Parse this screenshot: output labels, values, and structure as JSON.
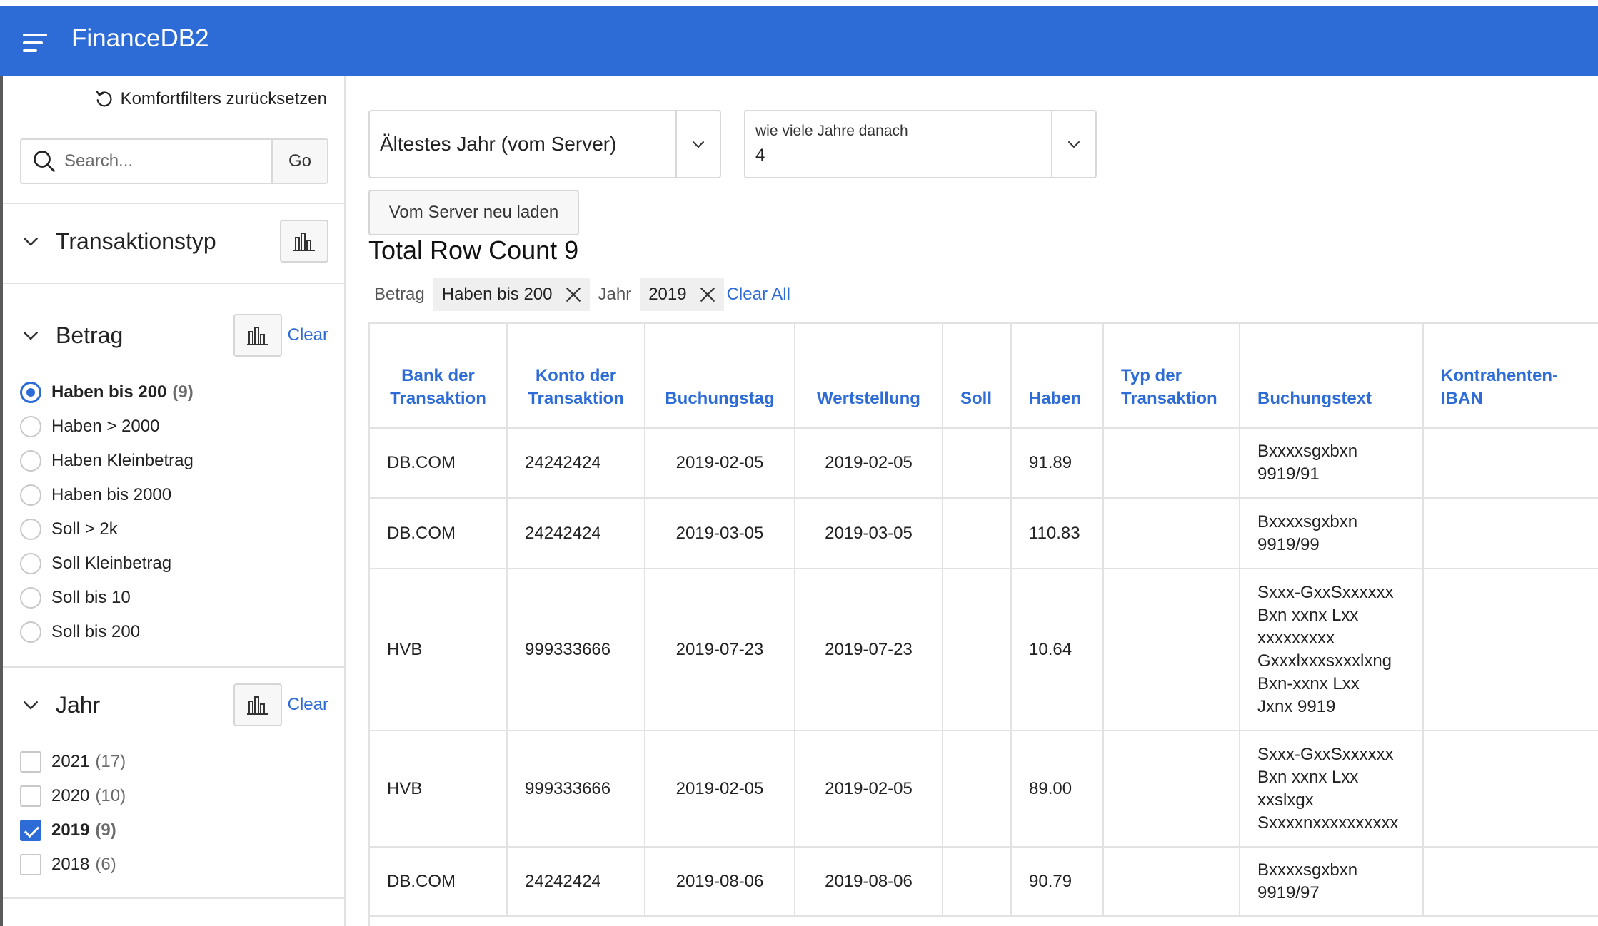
{
  "header": {
    "app_title": "FinanceDB2"
  },
  "sidebar": {
    "reset_label": "Komfortfilters zurücksetzen",
    "search_placeholder": "Search...",
    "go_label": "Go",
    "facets": [
      {
        "title": "Transaktionstyp"
      },
      {
        "title": "Betrag",
        "clear_label": "Clear",
        "options": [
          {
            "label": "Haben bis 200",
            "count": "(9)",
            "selected": true
          },
          {
            "label": "Haben > 2000",
            "count": ""
          },
          {
            "label": "Haben Kleinbetrag",
            "count": ""
          },
          {
            "label": "Haben bis 2000",
            "count": ""
          },
          {
            "label": "Soll > 2k",
            "count": ""
          },
          {
            "label": "Soll Kleinbetrag",
            "count": ""
          },
          {
            "label": "Soll bis 10",
            "count": ""
          },
          {
            "label": "Soll bis 200",
            "count": ""
          }
        ]
      },
      {
        "title": "Jahr",
        "clear_label": "Clear",
        "options": [
          {
            "label": "2021",
            "count": "(17)"
          },
          {
            "label": "2020",
            "count": "(10)"
          },
          {
            "label": "2019",
            "count": "(9)",
            "selected": true
          },
          {
            "label": "2018",
            "count": "(6)"
          }
        ]
      }
    ]
  },
  "main": {
    "select_year": {
      "value": "Ältestes Jahr (vom Server)"
    },
    "select_years_after": {
      "label": "wie viele Jahre danach",
      "value": "4"
    },
    "reload_button": "Vom Server neu laden",
    "row_count": "Total Row Count 9",
    "chips": [
      {
        "label": "Betrag",
        "value": "Haben bis 200"
      },
      {
        "label": "Jahr",
        "value": "2019"
      }
    ],
    "clear_all": "Clear All"
  },
  "table": {
    "columns": [
      [
        "Bank der",
        "Transaktion"
      ],
      [
        "Konto der",
        "Transaktion"
      ],
      [
        "Buchungstag"
      ],
      [
        "Wertstellung"
      ],
      [
        "Soll"
      ],
      [
        "Haben"
      ],
      [
        "Typ der",
        "Transaktion"
      ],
      [
        "Buchungstext"
      ],
      [
        "Kontrahenten-",
        "IBAN"
      ]
    ],
    "rows": [
      {
        "bank": "DB.COM",
        "konto": "24242424",
        "buchungstag": "2019-02-05",
        "wertstellung": "2019-02-05",
        "soll": "",
        "haben": "91.89",
        "typ": "",
        "text": [
          "Bxxxxsgxbxn",
          "9919/91"
        ],
        "iban": ""
      },
      {
        "bank": "DB.COM",
        "konto": "24242424",
        "buchungstag": "2019-03-05",
        "wertstellung": "2019-03-05",
        "soll": "",
        "haben": "110.83",
        "typ": "",
        "text": [
          "Bxxxxsgxbxn",
          "9919/99"
        ],
        "iban": ""
      },
      {
        "bank": "HVB",
        "konto": "999333666",
        "buchungstag": "2019-07-23",
        "wertstellung": "2019-07-23",
        "soll": "",
        "haben": "10.64",
        "typ": "",
        "text": [
          "Sxxx-GxxSxxxxxx",
          "Bxn xxnx Lxx",
          "xxxxxxxxx",
          "Gxxxlxxxsxxxlxng",
          "Bxn-xxnx Lxx",
          "Jxnx 9919"
        ],
        "iban": ""
      },
      {
        "bank": "HVB",
        "konto": "999333666",
        "buchungstag": "2019-02-05",
        "wertstellung": "2019-02-05",
        "soll": "",
        "haben": "89.00",
        "typ": "",
        "text": [
          "Sxxx-GxxSxxxxxx",
          "Bxn xxnx Lxx",
          "xxslxgx",
          "Sxxxxnxxxxxxxxxx"
        ],
        "iban": ""
      },
      {
        "bank": "DB.COM",
        "konto": "24242424",
        "buchungstag": "2019-08-06",
        "wertstellung": "2019-08-06",
        "soll": "",
        "haben": "90.79",
        "typ": "",
        "text": [
          "Bxxxxsgxbxn",
          "9919/97"
        ],
        "iban": ""
      }
    ]
  },
  "colors": {
    "accent": "#2d6bd6",
    "header_bg": "#2d6bd6",
    "border": "#e2e2e2"
  },
  "icons": [
    "menu-icon",
    "reset-icon",
    "search-icon",
    "chevron-down-icon",
    "bar-chart-icon",
    "close-icon"
  ]
}
